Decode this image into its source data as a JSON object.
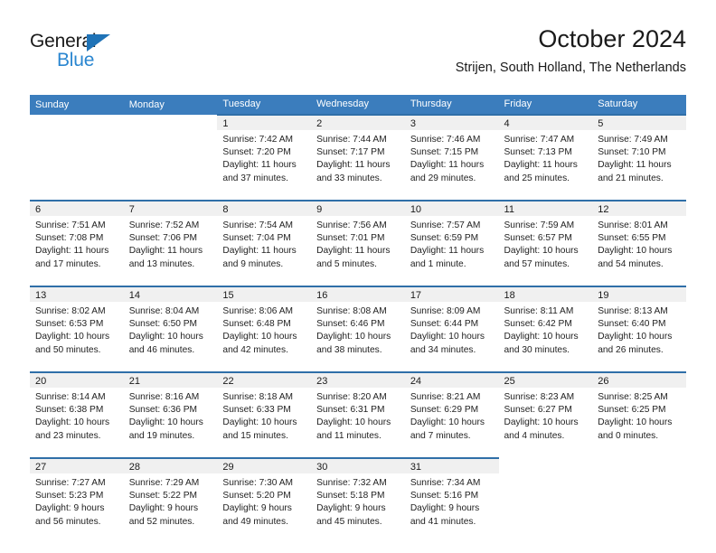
{
  "brand": {
    "name_top": "General",
    "name_bottom": "Blue",
    "triangle_color": "#1f73b7",
    "blue_text_color": "#2a86d0"
  },
  "header": {
    "title": "October 2024",
    "subtitle": "Strijen, South Holland, The Netherlands"
  },
  "theme": {
    "header_row_bg": "#3b7dbd",
    "cell_top_border": "#2f6fa8",
    "daynum_band_bg": "#f0f0f0"
  },
  "weekday_headers": [
    "Sunday",
    "Monday",
    "Tuesday",
    "Wednesday",
    "Thursday",
    "Friday",
    "Saturday"
  ],
  "labels": {
    "sunrise_prefix": "Sunrise: ",
    "sunset_prefix": "Sunset: ",
    "daylight_prefix": "Daylight: "
  },
  "weeks": [
    [
      {
        "day": ""
      },
      {
        "day": ""
      },
      {
        "day": "1",
        "sunrise": "Sunrise: 7:42 AM",
        "sunset": "Sunset: 7:20 PM",
        "daylight": "Daylight: 11 hours and 37 minutes."
      },
      {
        "day": "2",
        "sunrise": "Sunrise: 7:44 AM",
        "sunset": "Sunset: 7:17 PM",
        "daylight": "Daylight: 11 hours and 33 minutes."
      },
      {
        "day": "3",
        "sunrise": "Sunrise: 7:46 AM",
        "sunset": "Sunset: 7:15 PM",
        "daylight": "Daylight: 11 hours and 29 minutes."
      },
      {
        "day": "4",
        "sunrise": "Sunrise: 7:47 AM",
        "sunset": "Sunset: 7:13 PM",
        "daylight": "Daylight: 11 hours and 25 minutes."
      },
      {
        "day": "5",
        "sunrise": "Sunrise: 7:49 AM",
        "sunset": "Sunset: 7:10 PM",
        "daylight": "Daylight: 11 hours and 21 minutes."
      }
    ],
    [
      {
        "day": "6",
        "sunrise": "Sunrise: 7:51 AM",
        "sunset": "Sunset: 7:08 PM",
        "daylight": "Daylight: 11 hours and 17 minutes."
      },
      {
        "day": "7",
        "sunrise": "Sunrise: 7:52 AM",
        "sunset": "Sunset: 7:06 PM",
        "daylight": "Daylight: 11 hours and 13 minutes."
      },
      {
        "day": "8",
        "sunrise": "Sunrise: 7:54 AM",
        "sunset": "Sunset: 7:04 PM",
        "daylight": "Daylight: 11 hours and 9 minutes."
      },
      {
        "day": "9",
        "sunrise": "Sunrise: 7:56 AM",
        "sunset": "Sunset: 7:01 PM",
        "daylight": "Daylight: 11 hours and 5 minutes."
      },
      {
        "day": "10",
        "sunrise": "Sunrise: 7:57 AM",
        "sunset": "Sunset: 6:59 PM",
        "daylight": "Daylight: 11 hours and 1 minute."
      },
      {
        "day": "11",
        "sunrise": "Sunrise: 7:59 AM",
        "sunset": "Sunset: 6:57 PM",
        "daylight": "Daylight: 10 hours and 57 minutes."
      },
      {
        "day": "12",
        "sunrise": "Sunrise: 8:01 AM",
        "sunset": "Sunset: 6:55 PM",
        "daylight": "Daylight: 10 hours and 54 minutes."
      }
    ],
    [
      {
        "day": "13",
        "sunrise": "Sunrise: 8:02 AM",
        "sunset": "Sunset: 6:53 PM",
        "daylight": "Daylight: 10 hours and 50 minutes."
      },
      {
        "day": "14",
        "sunrise": "Sunrise: 8:04 AM",
        "sunset": "Sunset: 6:50 PM",
        "daylight": "Daylight: 10 hours and 46 minutes."
      },
      {
        "day": "15",
        "sunrise": "Sunrise: 8:06 AM",
        "sunset": "Sunset: 6:48 PM",
        "daylight": "Daylight: 10 hours and 42 minutes."
      },
      {
        "day": "16",
        "sunrise": "Sunrise: 8:08 AM",
        "sunset": "Sunset: 6:46 PM",
        "daylight": "Daylight: 10 hours and 38 minutes."
      },
      {
        "day": "17",
        "sunrise": "Sunrise: 8:09 AM",
        "sunset": "Sunset: 6:44 PM",
        "daylight": "Daylight: 10 hours and 34 minutes."
      },
      {
        "day": "18",
        "sunrise": "Sunrise: 8:11 AM",
        "sunset": "Sunset: 6:42 PM",
        "daylight": "Daylight: 10 hours and 30 minutes."
      },
      {
        "day": "19",
        "sunrise": "Sunrise: 8:13 AM",
        "sunset": "Sunset: 6:40 PM",
        "daylight": "Daylight: 10 hours and 26 minutes."
      }
    ],
    [
      {
        "day": "20",
        "sunrise": "Sunrise: 8:14 AM",
        "sunset": "Sunset: 6:38 PM",
        "daylight": "Daylight: 10 hours and 23 minutes."
      },
      {
        "day": "21",
        "sunrise": "Sunrise: 8:16 AM",
        "sunset": "Sunset: 6:36 PM",
        "daylight": "Daylight: 10 hours and 19 minutes."
      },
      {
        "day": "22",
        "sunrise": "Sunrise: 8:18 AM",
        "sunset": "Sunset: 6:33 PM",
        "daylight": "Daylight: 10 hours and 15 minutes."
      },
      {
        "day": "23",
        "sunrise": "Sunrise: 8:20 AM",
        "sunset": "Sunset: 6:31 PM",
        "daylight": "Daylight: 10 hours and 11 minutes."
      },
      {
        "day": "24",
        "sunrise": "Sunrise: 8:21 AM",
        "sunset": "Sunset: 6:29 PM",
        "daylight": "Daylight: 10 hours and 7 minutes."
      },
      {
        "day": "25",
        "sunrise": "Sunrise: 8:23 AM",
        "sunset": "Sunset: 6:27 PM",
        "daylight": "Daylight: 10 hours and 4 minutes."
      },
      {
        "day": "26",
        "sunrise": "Sunrise: 8:25 AM",
        "sunset": "Sunset: 6:25 PM",
        "daylight": "Daylight: 10 hours and 0 minutes."
      }
    ],
    [
      {
        "day": "27",
        "sunrise": "Sunrise: 7:27 AM",
        "sunset": "Sunset: 5:23 PM",
        "daylight": "Daylight: 9 hours and 56 minutes."
      },
      {
        "day": "28",
        "sunrise": "Sunrise: 7:29 AM",
        "sunset": "Sunset: 5:22 PM",
        "daylight": "Daylight: 9 hours and 52 minutes."
      },
      {
        "day": "29",
        "sunrise": "Sunrise: 7:30 AM",
        "sunset": "Sunset: 5:20 PM",
        "daylight": "Daylight: 9 hours and 49 minutes."
      },
      {
        "day": "30",
        "sunrise": "Sunrise: 7:32 AM",
        "sunset": "Sunset: 5:18 PM",
        "daylight": "Daylight: 9 hours and 45 minutes."
      },
      {
        "day": "31",
        "sunrise": "Sunrise: 7:34 AM",
        "sunset": "Sunset: 5:16 PM",
        "daylight": "Daylight: 9 hours and 41 minutes."
      },
      {
        "day": ""
      },
      {
        "day": ""
      }
    ]
  ]
}
